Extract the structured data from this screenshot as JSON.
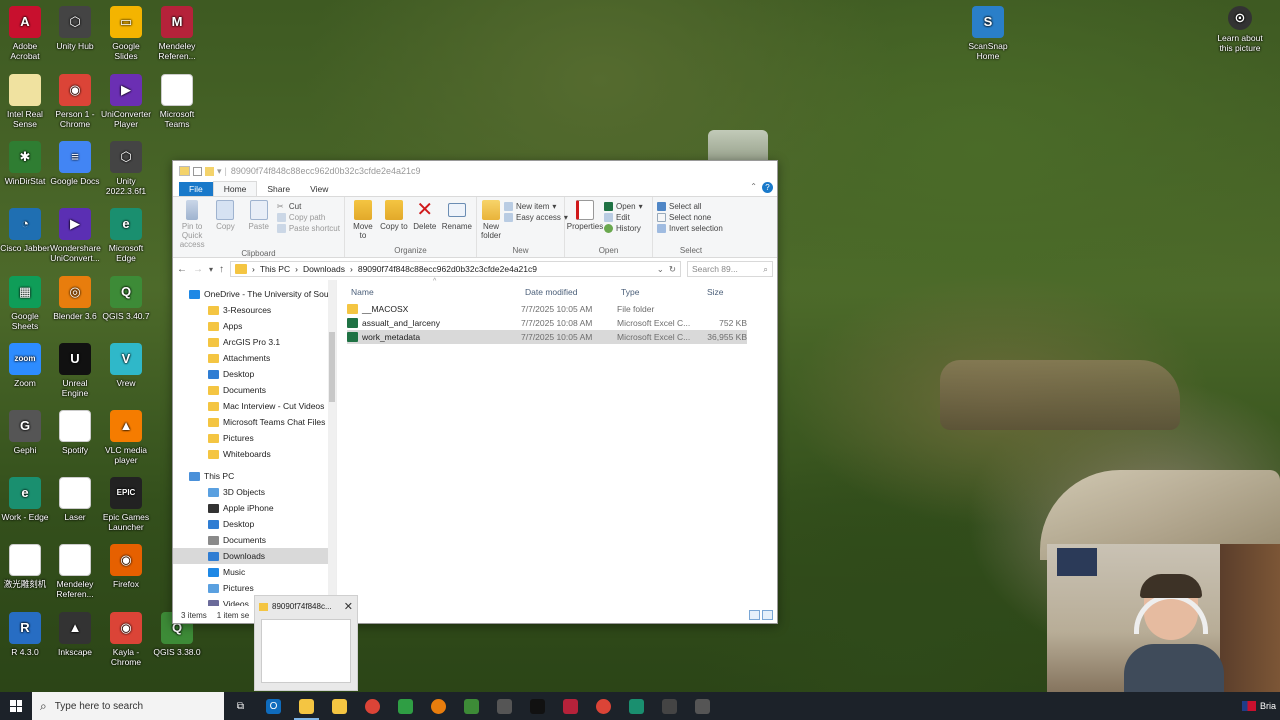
{
  "desktop": {
    "left_icons": [
      {
        "label": "Adobe Acrobat",
        "color": "#c8102e",
        "glyph": "A"
      },
      {
        "label": "Unity Hub",
        "color": "#444444",
        "glyph": "⬡"
      },
      {
        "label": "Google Slides",
        "color": "#f4b400",
        "glyph": "▭"
      },
      {
        "label": "Mendeley Referen...",
        "color": "#b5223a",
        "glyph": "M"
      },
      {
        "label": "Intel Real Sense",
        "color": "#f0e2a0",
        "glyph": ""
      },
      {
        "label": "Person 1 - Chrome",
        "color": "#db4437",
        "glyph": "◉"
      },
      {
        "label": "UniConverter Player",
        "color": "#6b2fb3",
        "glyph": "▶"
      },
      {
        "label": "Microsoft Teams",
        "color": "#ffffff",
        "glyph": ""
      },
      {
        "label": "WinDirStat",
        "color": "#2f7d32",
        "glyph": "✱"
      },
      {
        "label": "Google Docs",
        "color": "#4285f4",
        "glyph": "≡"
      },
      {
        "label": "Unity 2022.3.6f1",
        "color": "#444444",
        "glyph": "⬡"
      },
      {
        "label": "Cisco Jabber",
        "color": "#1f6fb2",
        "glyph": "◔"
      },
      {
        "label": "Wondershare UniConvert...",
        "color": "#5b2fb3",
        "glyph": "▶"
      },
      {
        "label": "Microsoft Edge",
        "color": "#1a8f6f",
        "glyph": "e"
      },
      {
        "label": "Google Sheets",
        "color": "#0f9d58",
        "glyph": "▦"
      },
      {
        "label": "Blender 3.6",
        "color": "#e87d0d",
        "glyph": "◎"
      },
      {
        "label": "QGIS 3.40.7",
        "color": "#3d8b37",
        "glyph": "Q"
      },
      {
        "label": "Zoom",
        "color": "#2d8cff",
        "glyph": "zoom"
      },
      {
        "label": "Unreal Engine",
        "color": "#111111",
        "glyph": "U"
      },
      {
        "label": "Vrew",
        "color": "#2fb8c9",
        "glyph": "V"
      },
      {
        "label": "Gephi",
        "color": "#555555",
        "glyph": "G"
      },
      {
        "label": "Spotify",
        "color": "#ffffff",
        "glyph": ""
      },
      {
        "label": "VLC media player",
        "color": "#f57c00",
        "glyph": "▲"
      },
      {
        "label": "Work - Edge",
        "color": "#1a8f6f",
        "glyph": "e"
      },
      {
        "label": "Laser",
        "color": "#ffffff",
        "glyph": ""
      },
      {
        "label": "Epic Games Launcher",
        "color": "#222222",
        "glyph": "EPIC"
      },
      {
        "label": "激光雕刻机",
        "color": "#ffffff",
        "glyph": ""
      },
      {
        "label": "Mendeley Referen...",
        "color": "#ffffff",
        "glyph": ""
      },
      {
        "label": "Firefox",
        "color": "#e66000",
        "glyph": "◉"
      },
      {
        "label": "R 4.3.0",
        "color": "#276dc3",
        "glyph": "R"
      },
      {
        "label": "Inkscape",
        "color": "#333333",
        "glyph": "▲"
      },
      {
        "label": "Kayla - Chrome",
        "color": "#db4437",
        "glyph": "◉"
      },
      {
        "label": "QGIS 3.38.0",
        "color": "#3d8b37",
        "glyph": "Q"
      }
    ],
    "right_icons": [
      {
        "label": "ScanSnap Home",
        "color": "#2a7fc9",
        "glyph": "S"
      },
      {
        "label": "Learn about this picture",
        "color": "#333333",
        "glyph": "⊙"
      }
    ]
  },
  "explorer": {
    "title": "89090f74f848c88ecc962d0b32c3cfde2e4a21c9",
    "tabs": [
      "File",
      "Home",
      "Share",
      "View"
    ],
    "ribbon": {
      "clipboard": {
        "label": "Clipboard",
        "pin": "Pin to Quick access",
        "copy": "Copy",
        "paste": "Paste",
        "cut": "Cut",
        "copy_path": "Copy path",
        "paste_shortcut": "Paste shortcut"
      },
      "organize": {
        "label": "Organize",
        "move_to": "Move to",
        "copy_to": "Copy to",
        "delete": "Delete",
        "rename": "Rename"
      },
      "new": {
        "label": "New",
        "new_folder": "New folder",
        "new_item": "New item",
        "easy_access": "Easy access"
      },
      "open": {
        "label": "Open",
        "properties": "Properties",
        "open": "Open",
        "edit": "Edit",
        "history": "History"
      },
      "select": {
        "label": "Select",
        "select_all": "Select all",
        "select_none": "Select none",
        "invert": "Invert selection"
      }
    },
    "address": {
      "crumbs": [
        "This PC",
        "Downloads",
        "89090f74f848c88ecc962d0b32c3cfde2e4a21c9"
      ],
      "search_placeholder": "Search 89..."
    },
    "nav": {
      "onedrive": "OneDrive - The University of Southern",
      "onedrive_items": [
        "3-Resources",
        "Apps",
        "ArcGIS Pro 3.1",
        "Attachments",
        "Desktop",
        "Documents",
        "Mac Interview - Cut Videos",
        "Microsoft Teams Chat Files",
        "Pictures",
        "Whiteboards"
      ],
      "thispc": "This PC",
      "thispc_items": [
        "3D Objects",
        "Apple iPhone",
        "Desktop",
        "Documents",
        "Downloads",
        "Music",
        "Pictures",
        "Videos"
      ]
    },
    "columns": [
      "Name",
      "Date modified",
      "Type",
      "Size"
    ],
    "files": [
      {
        "name": "__MACOSX",
        "date": "7/7/2025 10:05 AM",
        "type": "File folder",
        "size": ""
      },
      {
        "name": "assualt_and_larceny",
        "date": "7/7/2025 10:08 AM",
        "type": "Microsoft Excel C...",
        "size": "752 KB"
      },
      {
        "name": "work_metadata",
        "date": "7/7/2025 10:05 AM",
        "type": "Microsoft Excel C...",
        "size": "36,955 KB"
      }
    ],
    "status": {
      "count": "3 items",
      "selected": "1 item se"
    }
  },
  "preview": {
    "title": "89090f74f848c..."
  },
  "taskbar": {
    "search_placeholder": "Type here to search",
    "user": "Bria"
  }
}
